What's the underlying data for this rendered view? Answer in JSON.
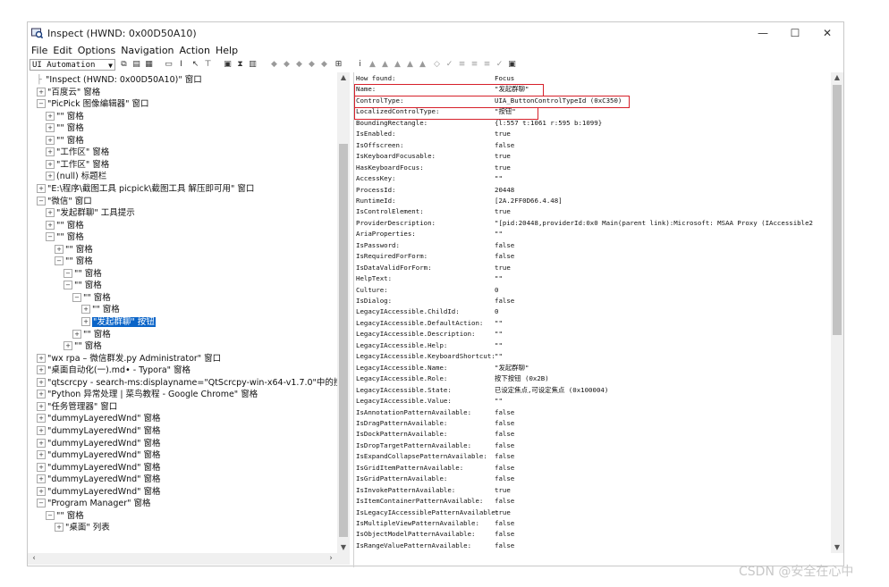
{
  "window": {
    "title": "Inspect  (HWND: 0x00D50A10)",
    "controls": {
      "minimize": "—",
      "maximize": "☐",
      "close": "✕"
    }
  },
  "menu": [
    "File",
    "Edit",
    "Options",
    "Navigation",
    "Action",
    "Help"
  ],
  "toolbar": {
    "mode_combo": "UI Automation"
  },
  "tree": [
    {
      "text": "\"Inspect  (HWND: 0x00D50A10)\" 窗口",
      "indent": 1,
      "exp": "line"
    },
    {
      "text": "\"百度云\" 窗格",
      "indent": 1,
      "exp": "+"
    },
    {
      "text": "\"PicPick 图像编辑器\" 窗口",
      "indent": 1,
      "exp": "−"
    },
    {
      "text": "\"\" 窗格",
      "indent": 2,
      "exp": "+"
    },
    {
      "text": "\"\" 窗格",
      "indent": 2,
      "exp": "+"
    },
    {
      "text": "\"\" 窗格",
      "indent": 2,
      "exp": "+"
    },
    {
      "text": "\"工作区\" 窗格",
      "indent": 2,
      "exp": "+"
    },
    {
      "text": "\"工作区\" 窗格",
      "indent": 2,
      "exp": "+"
    },
    {
      "text": "(null) 标题栏",
      "indent": 2,
      "exp": "+"
    },
    {
      "text": "\"E:\\程序\\截图工具 picpick\\截图工具 解压即可用\" 窗口",
      "indent": 1,
      "exp": "+"
    },
    {
      "text": "\"微信\" 窗口",
      "indent": 1,
      "exp": "−"
    },
    {
      "text": "\"发起群聊\" 工具提示",
      "indent": 2,
      "exp": "+"
    },
    {
      "text": "\"\" 窗格",
      "indent": 2,
      "exp": "+"
    },
    {
      "text": "\"\" 窗格",
      "indent": 2,
      "exp": "−"
    },
    {
      "text": "\"\" 窗格",
      "indent": 3,
      "exp": "+"
    },
    {
      "text": "\"\" 窗格",
      "indent": 3,
      "exp": "−"
    },
    {
      "text": "\"\" 窗格",
      "indent": 4,
      "exp": "−"
    },
    {
      "text": "\"\" 窗格",
      "indent": 4,
      "exp": "−"
    },
    {
      "text": "\"\" 窗格",
      "indent": 5,
      "exp": "−"
    },
    {
      "text": "\"\" 窗格",
      "indent": 6,
      "exp": "+"
    },
    {
      "text": "\"发起群聊\" 按钮",
      "indent": 6,
      "exp": "+",
      "selected": true
    },
    {
      "text": "\"\" 窗格",
      "indent": 5,
      "exp": "+"
    },
    {
      "text": "\"\" 窗格",
      "indent": 4,
      "exp": "+"
    },
    {
      "text": "\"wx rpa – 微信群发.py Administrator\" 窗口",
      "indent": 1,
      "exp": "+"
    },
    {
      "text": "\"桌面自动化(一).md• - Typora\" 窗格",
      "indent": 1,
      "exp": "+"
    },
    {
      "text": "\"qtscrcpy - search-ms:displayname=\"QtScrcpy-win-x64-v1.7.0\"中的搜索结",
      "indent": 1,
      "exp": "+"
    },
    {
      "text": "\"Python 异常处理 | 菜鸟教程 - Google Chrome\" 窗格",
      "indent": 1,
      "exp": "+"
    },
    {
      "text": "\"任务管理器\" 窗口",
      "indent": 1,
      "exp": "+"
    },
    {
      "text": "\"dummyLayeredWnd\" 窗格",
      "indent": 1,
      "exp": "+"
    },
    {
      "text": "\"dummyLayeredWnd\" 窗格",
      "indent": 1,
      "exp": "+"
    },
    {
      "text": "\"dummyLayeredWnd\" 窗格",
      "indent": 1,
      "exp": "+"
    },
    {
      "text": "\"dummyLayeredWnd\" 窗格",
      "indent": 1,
      "exp": "+"
    },
    {
      "text": "\"dummyLayeredWnd\" 窗格",
      "indent": 1,
      "exp": "+"
    },
    {
      "text": "\"dummyLayeredWnd\" 窗格",
      "indent": 1,
      "exp": "+"
    },
    {
      "text": "\"dummyLayeredWnd\" 窗格",
      "indent": 1,
      "exp": "+"
    },
    {
      "text": "\"Program Manager\" 窗格",
      "indent": 1,
      "exp": "−"
    },
    {
      "text": "\"\" 窗格",
      "indent": 2,
      "exp": "−"
    },
    {
      "text": "\"桌面\" 列表",
      "indent": 3,
      "exp": "+"
    }
  ],
  "properties": [
    {
      "k": "How found:",
      "v": "Focus"
    },
    {
      "k": "Name:",
      "v": "\"发起群聊\""
    },
    {
      "k": "ControlType:",
      "v": "UIA_ButtonControlTypeId (0xC350)"
    },
    {
      "k": "LocalizedControlType:",
      "v": "\"按钮\""
    },
    {
      "k": "BoundingRectangle:",
      "v": "{l:557 t:1061 r:595 b:1099}"
    },
    {
      "k": "IsEnabled:",
      "v": "true"
    },
    {
      "k": "IsOffscreen:",
      "v": "false"
    },
    {
      "k": "IsKeyboardFocusable:",
      "v": "true"
    },
    {
      "k": "HasKeyboardFocus:",
      "v": "true"
    },
    {
      "k": "AccessKey:",
      "v": "\"\""
    },
    {
      "k": "ProcessId:",
      "v": "20448"
    },
    {
      "k": "RuntimeId:",
      "v": "[2A.2FF0D66.4.48]"
    },
    {
      "k": "IsControlElement:",
      "v": "true"
    },
    {
      "k": "ProviderDescription:",
      "v": "\"[pid:20448,providerId:0x0 Main(parent link):Microsoft: MSAA Proxy (IAccessible2"
    },
    {
      "k": "AriaProperties:",
      "v": "\"\""
    },
    {
      "k": "IsPassword:",
      "v": "false"
    },
    {
      "k": "IsRequiredForForm:",
      "v": "false"
    },
    {
      "k": "IsDataValidForForm:",
      "v": "true"
    },
    {
      "k": "HelpText:",
      "v": "\"\""
    },
    {
      "k": "Culture:",
      "v": "0"
    },
    {
      "k": "IsDialog:",
      "v": "false"
    },
    {
      "k": "LegacyIAccessible.ChildId:",
      "v": "0"
    },
    {
      "k": "LegacyIAccessible.DefaultAction:",
      "v": "\"\""
    },
    {
      "k": "LegacyIAccessible.Description:",
      "v": "\"\""
    },
    {
      "k": "LegacyIAccessible.Help:",
      "v": "\"\""
    },
    {
      "k": "LegacyIAccessible.KeyboardShortcut:",
      "v": "     \"\""
    },
    {
      "k": "LegacyIAccessible.Name:",
      "v": "\"发起群聊\""
    },
    {
      "k": "LegacyIAccessible.Role:",
      "v": "按下按钮 (0x2B)"
    },
    {
      "k": "LegacyIAccessible.State:",
      "v": "已设定焦点,可设定焦点 (0x100004)"
    },
    {
      "k": "LegacyIAccessible.Value:",
      "v": "\"\""
    },
    {
      "k": "IsAnnotationPatternAvailable:",
      "v": "false"
    },
    {
      "k": "IsDragPatternAvailable:",
      "v": "false"
    },
    {
      "k": "IsDockPatternAvailable:",
      "v": "false"
    },
    {
      "k": "IsDropTargetPatternAvailable:",
      "v": "false"
    },
    {
      "k": "IsExpandCollapsePatternAvailable:",
      "v": "false"
    },
    {
      "k": "IsGridItemPatternAvailable:",
      "v": "false"
    },
    {
      "k": "IsGridPatternAvailable:",
      "v": "false"
    },
    {
      "k": "IsInvokePatternAvailable:",
      "v": "true"
    },
    {
      "k": "IsItemContainerPatternAvailable:",
      "v": "false"
    },
    {
      "k": "IsLegacyIAccessiblePatternAvailable:",
      "v": "     true"
    },
    {
      "k": "IsMultipleViewPatternAvailable:",
      "v": "false"
    },
    {
      "k": "IsObjectModelPatternAvailable:",
      "v": "false"
    },
    {
      "k": "IsRangeValuePatternAvailable:",
      "v": "false"
    }
  ],
  "watermark": "CSDN @安全在心中",
  "colors": {
    "selection": "#0a64c8",
    "highlight_box": "#d6202a"
  }
}
